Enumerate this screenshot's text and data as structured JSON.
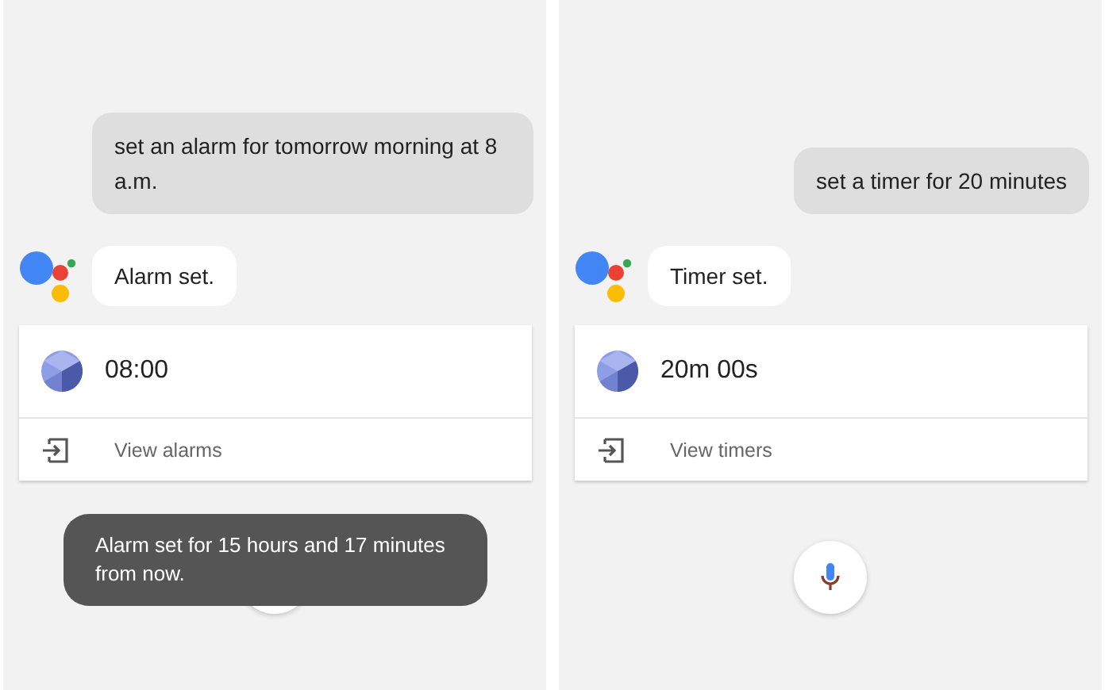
{
  "panels": [
    {
      "user_message": "set an alarm for tomorrow morning at 8 a.m.",
      "reply": "Alarm set.",
      "card": {
        "value": "08:00",
        "action": "View alarms"
      },
      "toast": "Alarm set for 15 hours and 17 minutes from now."
    },
    {
      "user_message": "set a timer for 20 minutes",
      "reply": "Timer set.",
      "card": {
        "value": "20m 00s",
        "action": "View timers"
      }
    }
  ]
}
